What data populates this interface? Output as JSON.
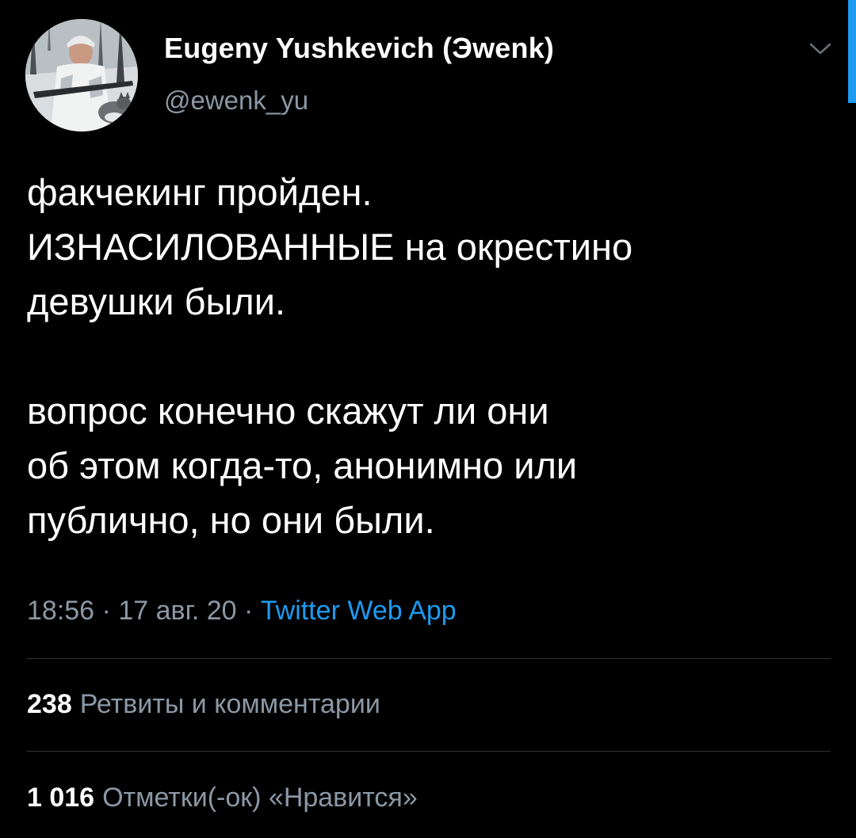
{
  "author": {
    "name": "Eugeny Yushkevich (Эwenk)",
    "handle": "@ewenk_yu"
  },
  "tweet": {
    "lines_1": [
      "факчекинг пройден.",
      "ИЗНАСИЛОВАННЫЕ на окрестино",
      "девушки были."
    ],
    "lines_2": [
      "вопрос конечно скажут ли они",
      "об этом когда-то, анонимно или",
      "публично, но они были."
    ]
  },
  "meta": {
    "time": "18:56",
    "separator": "·",
    "date": "17 авг. 20",
    "source": "Twitter Web App"
  },
  "stats": {
    "retweets_count": "238",
    "retweets_label": "Ретвиты и комментарии",
    "likes_count": "1 016",
    "likes_label": "Отметки(-ок) «Нравится»"
  },
  "colors": {
    "background": "#000000",
    "secondary_text": "#8b98a5",
    "accent": "#1d9bf0",
    "divider": "#2f3336"
  },
  "icons": {
    "more": "chevron-down-icon",
    "avatar": "profile-photo"
  }
}
